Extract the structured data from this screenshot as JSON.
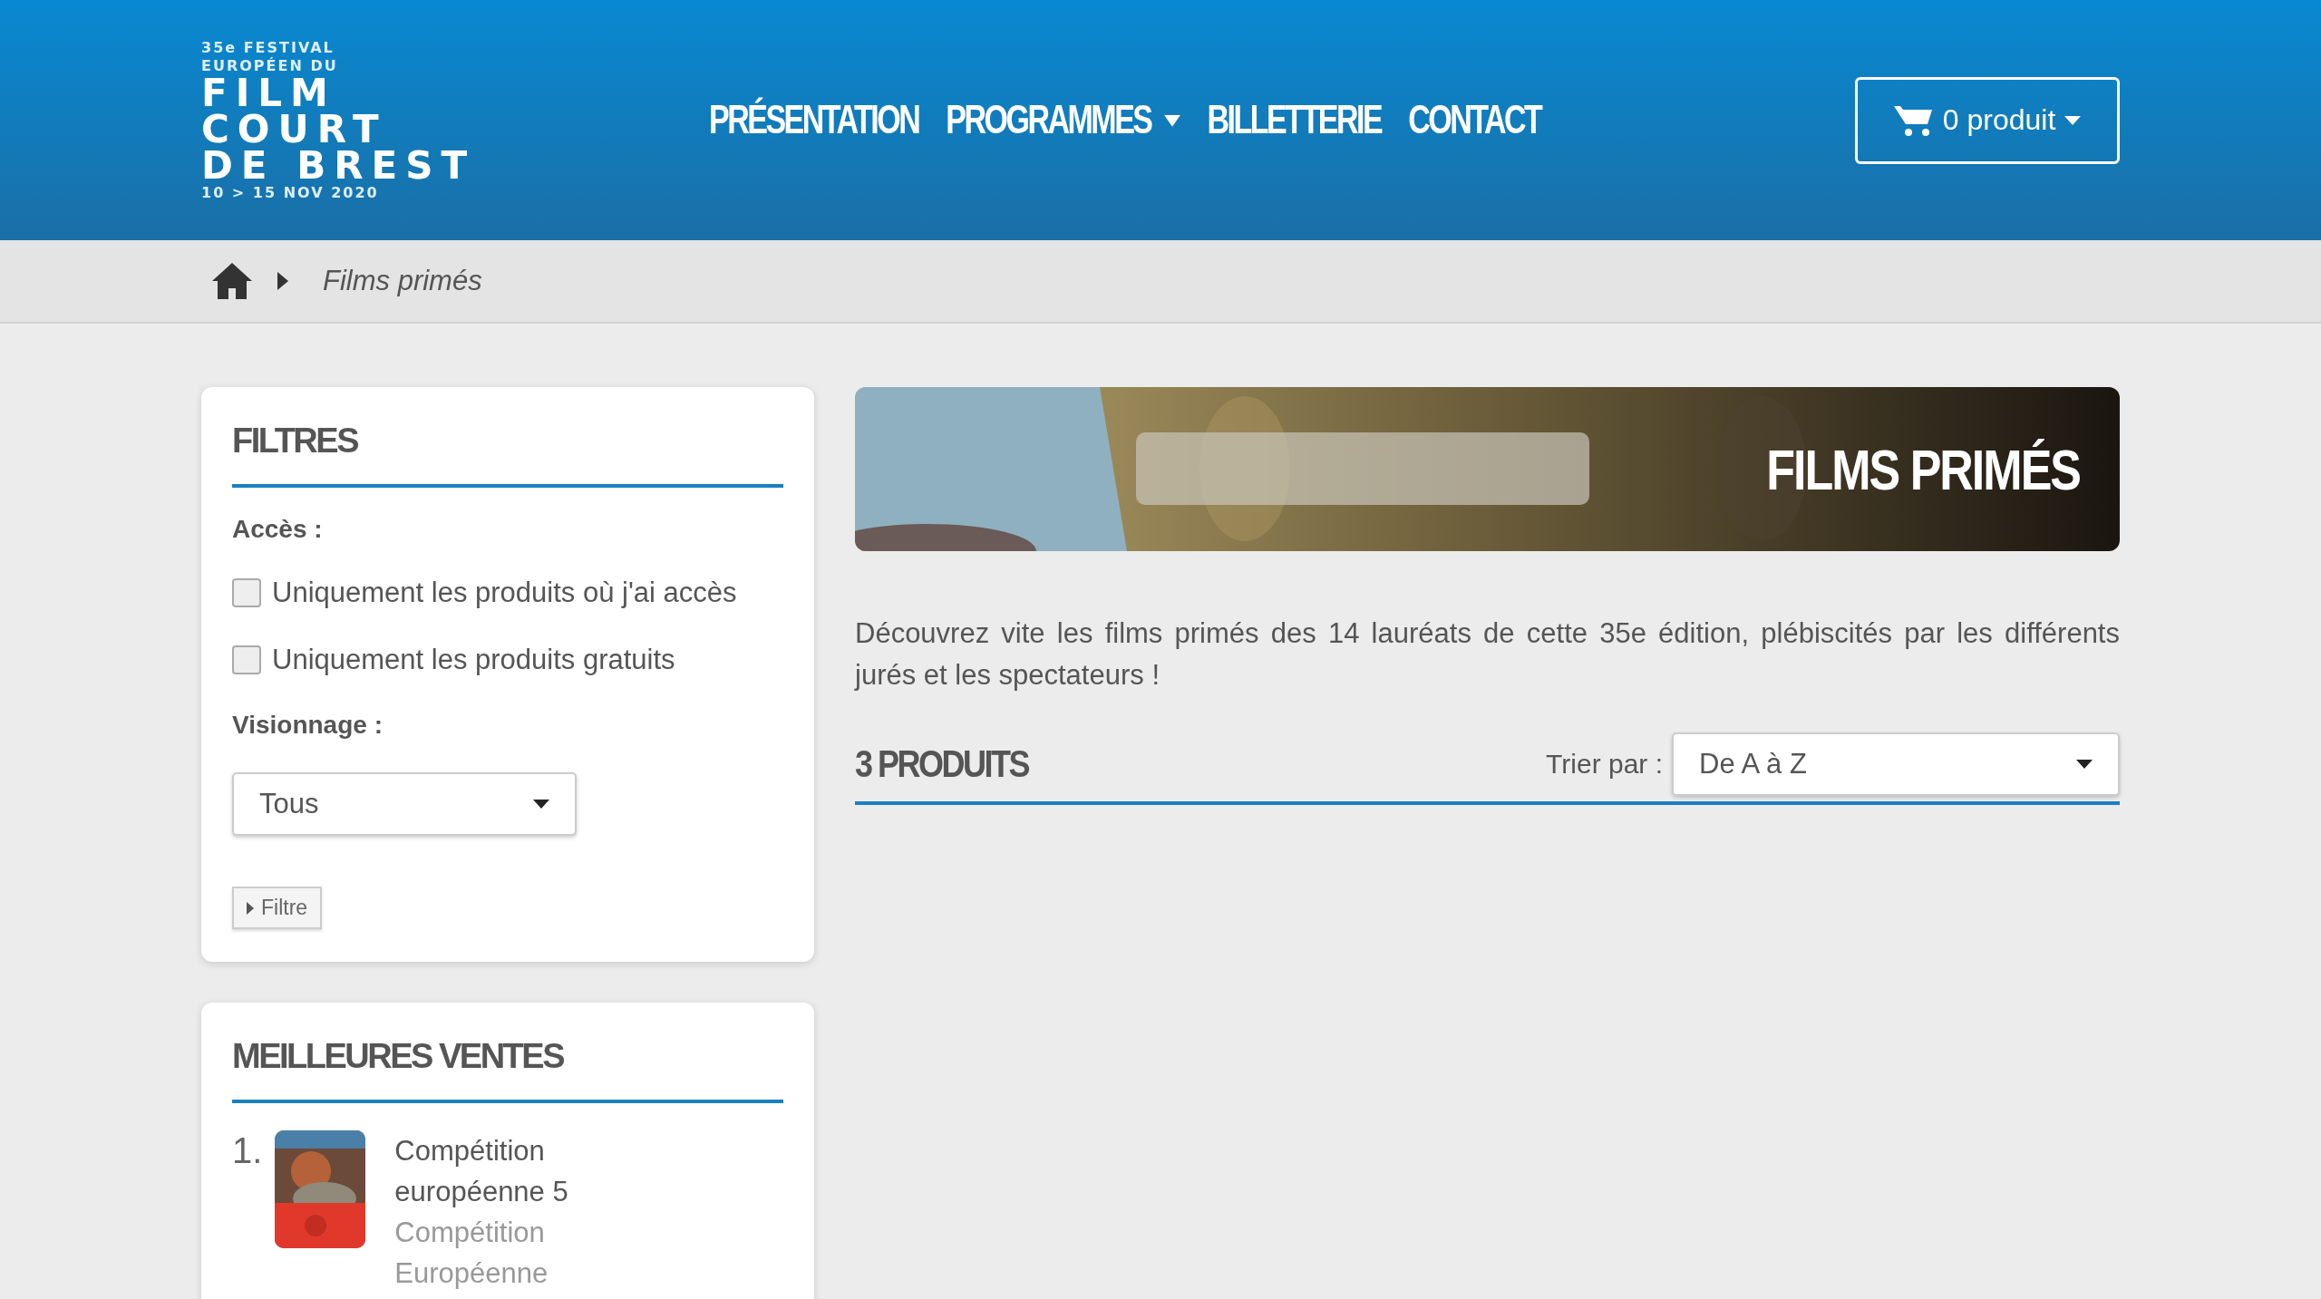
{
  "logo": {
    "lines": [
      "35e FESTIVAL",
      "EUROPÉEN DU",
      "FILM",
      "COURT",
      "DE BREST",
      "10 > 15 NOV 2020"
    ]
  },
  "nav": [
    {
      "label": "PRÉSENTATION",
      "dropdown": false
    },
    {
      "label": "PROGRAMMES",
      "dropdown": true
    },
    {
      "label": "BILLETTERIE",
      "dropdown": false
    },
    {
      "label": "CONTACT",
      "dropdown": false
    }
  ],
  "cart": {
    "label": "0 produit"
  },
  "breadcrumb": {
    "current": "Films primés"
  },
  "filters": {
    "title": "FILTRES",
    "access_label": "Accès :",
    "options": [
      {
        "label": "Uniquement les produits où j'ai accès",
        "checked": false
      },
      {
        "label": "Uniquement les produits gratuits",
        "checked": false
      }
    ],
    "viewing_label": "Visionnage :",
    "viewing_value": "Tous",
    "button": "Filtre"
  },
  "bestsellers": {
    "title": "MEILLEURES VENTES",
    "items": [
      {
        "rank": "1.",
        "name": "Compétition européenne 5",
        "category": "Compétition Européenne"
      }
    ]
  },
  "banner": {
    "title": "FILMS PRIMÉS"
  },
  "description": "Découvrez vite les films primés des 14 lauréats de cette 35e édition, plébiscités par les différents jurés et les spectateurs !",
  "products": {
    "count": "3 PRODUITS",
    "sort_label": "Trier par :",
    "sort_value": "De A à Z"
  }
}
